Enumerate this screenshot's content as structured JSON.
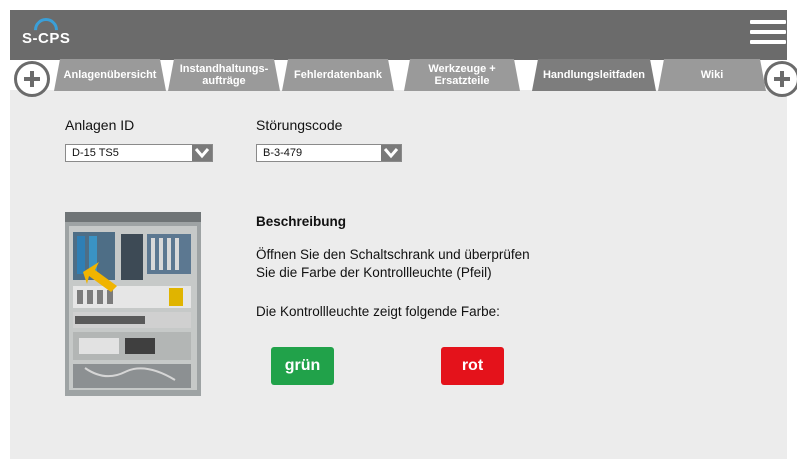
{
  "app": {
    "logo_text": "S-CPS"
  },
  "tabs": [
    {
      "label": "Anlagenübersicht"
    },
    {
      "label": "Instandhaltungs-\naufträge"
    },
    {
      "label": "Fehlerdatenbank"
    },
    {
      "label": "Werkzeuge +\nErsatzteile"
    },
    {
      "label": "Handlungsleitfaden",
      "active": true
    },
    {
      "label": "Wiki"
    }
  ],
  "form": {
    "anlagen_label": "Anlagen ID",
    "anlagen_value": "D-15 TS5",
    "stoerung_label": "Störungscode",
    "stoerung_value": "B-3-479"
  },
  "content": {
    "heading": "Beschreibung",
    "instruction_line1": "Öffnen Sie den Schaltschrank und überprüfen",
    "instruction_line2": "Sie die Farbe der Kontrollleuchte (Pfeil)",
    "question": "Die Kontrollleuchte zeigt folgende Farbe:"
  },
  "buttons": {
    "green_label": "grün",
    "red_label": "rot"
  },
  "colors": {
    "topbar": "#6b6b6b",
    "tab": "#9a9a9a",
    "green": "#21a24a",
    "red": "#e4121b"
  }
}
